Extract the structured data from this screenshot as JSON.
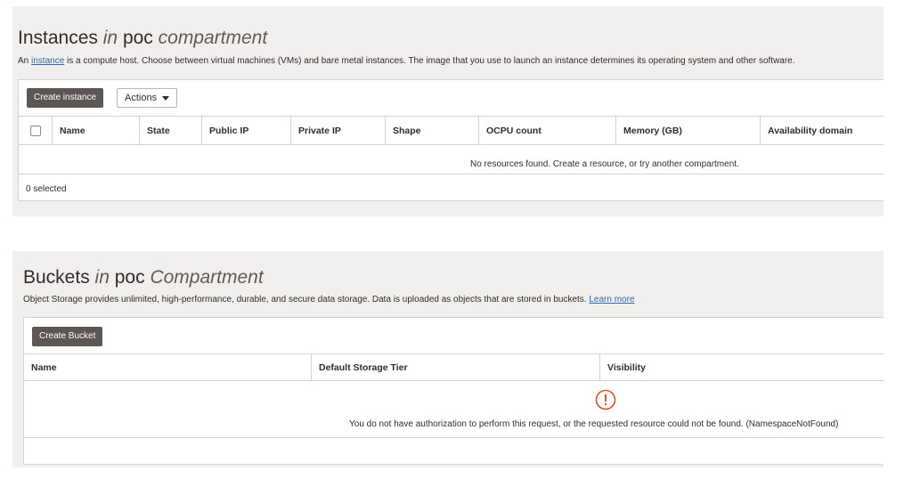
{
  "instances": {
    "title_main": "Instances",
    "title_in": "in",
    "title_comp": "poc",
    "title_compartment": "compartment",
    "desc_prefix": "An",
    "desc_link": "instance",
    "desc_suffix": "is a compute host. Choose between virtual machines (VMs) and bare metal instances. The image that you use to launch an instance determines its operating system and other software.",
    "create_button": "Create instance",
    "actions_button": "Actions",
    "columns": [
      "Name",
      "State",
      "Public IP",
      "Private IP",
      "Shape",
      "OCPU count",
      "Memory (GB)",
      "Availability domain"
    ],
    "empty_message": "No resources found. Create a resource, or try another compartment.",
    "selected_count": "0 selected"
  },
  "buckets": {
    "title_main": "Buckets",
    "title_in": "in",
    "title_comp": "poc",
    "title_compartment": "Compartment",
    "desc_text": "Object Storage provides unlimited, high-performance, durable, and secure data storage. Data is uploaded as objects that are stored in buckets.",
    "desc_link": "Learn more",
    "create_button": "Create Bucket",
    "columns": [
      "Name",
      "Default Storage Tier",
      "Visibility"
    ],
    "error_message": "You do not have authorization to perform this request, or the requested resource could not be found. (NamespaceNotFound)"
  },
  "colors": {
    "panel_bg": "#f1efed",
    "primary_button": "#5c5754",
    "link": "#2f6ba8",
    "error": "#d4512b"
  }
}
